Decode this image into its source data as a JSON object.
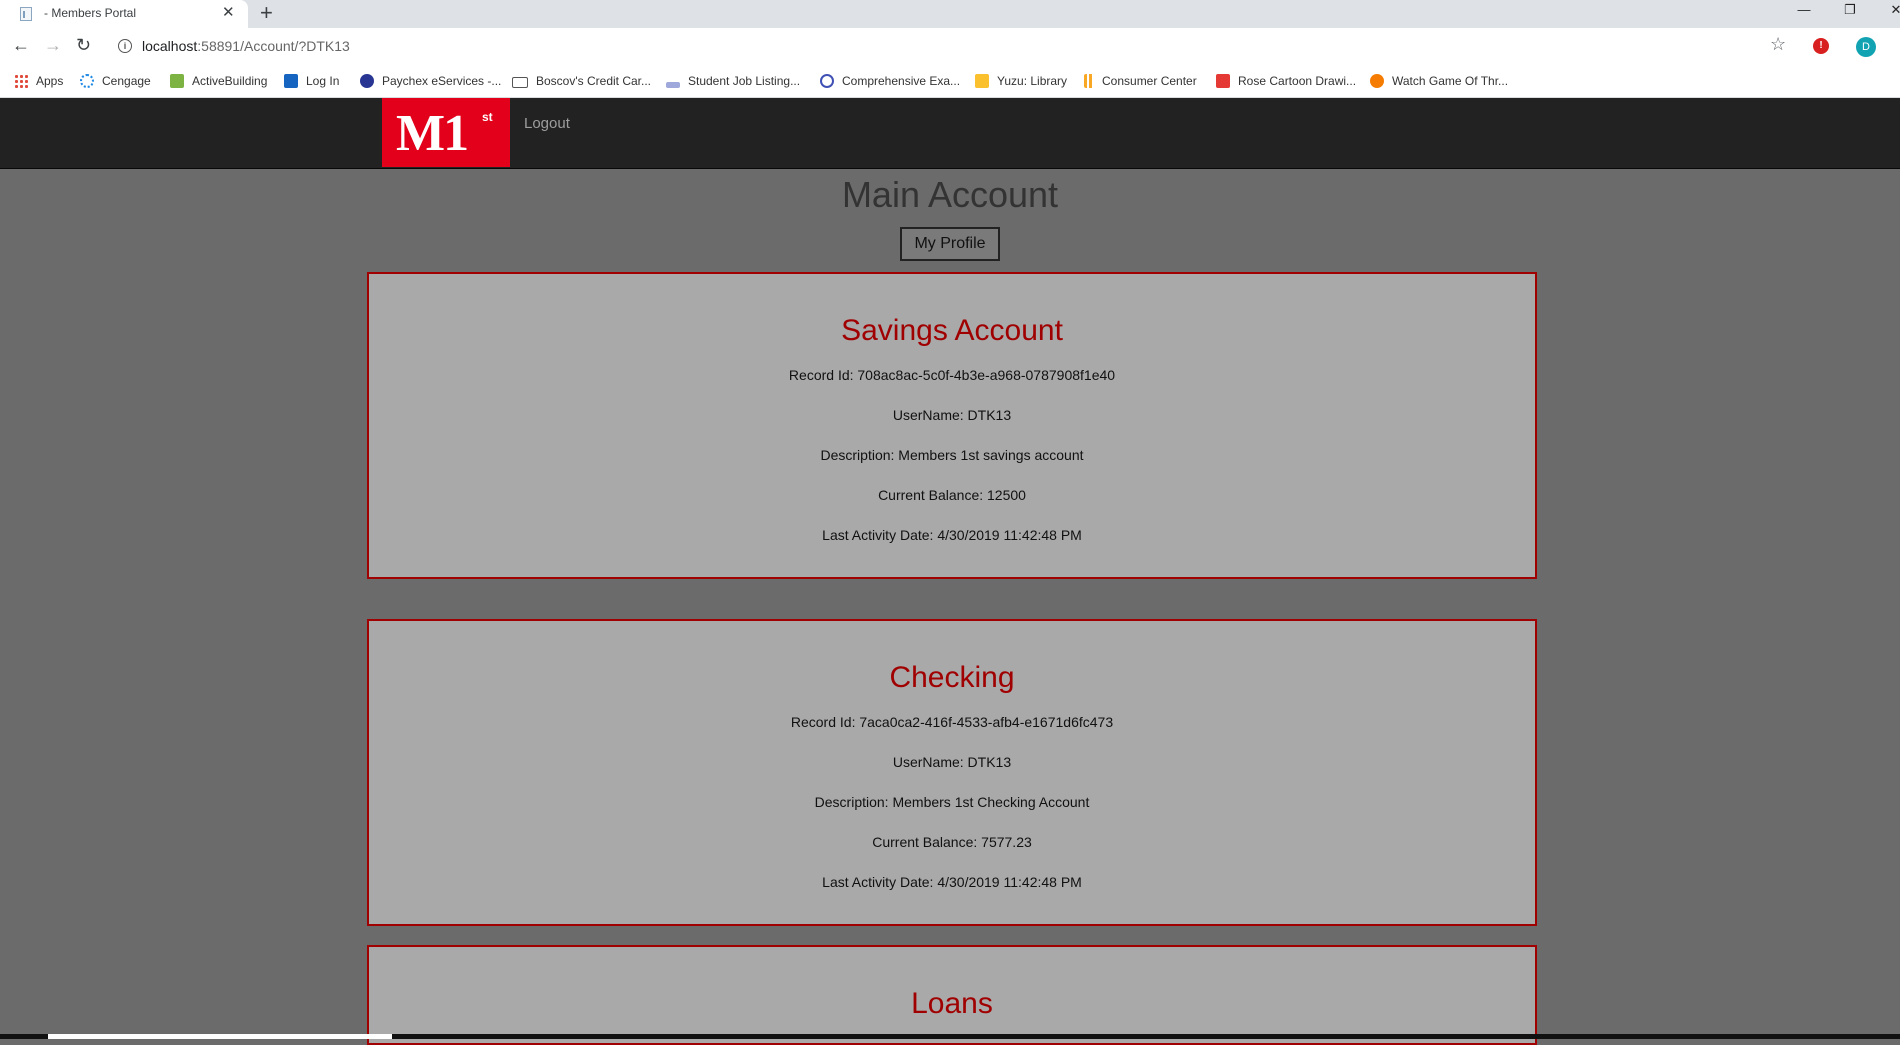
{
  "browser": {
    "tab_title": "- Members Portal",
    "new_tab": "+",
    "url_host": "localhost",
    "url_path": ":58891/Account/?DTK13",
    "avatar_letter": "D",
    "bookmarks": [
      {
        "label": "Apps",
        "icon": "apps-icon"
      },
      {
        "label": "Cengage",
        "icon": "cengage-icon",
        "color": "#1e88e5"
      },
      {
        "label": "ActiveBuilding",
        "icon": "building-icon",
        "color": "#7cb342"
      },
      {
        "label": "Log In",
        "icon": "login-icon",
        "color": "#1565c0"
      },
      {
        "label": "Paychex eServices -...",
        "icon": "paychex-icon",
        "color": "#283593"
      },
      {
        "label": "Boscov's Credit Car...",
        "icon": "card-icon",
        "color": "#555555"
      },
      {
        "label": "Student Job Listing...",
        "icon": "job-icon",
        "color": "#3949ab"
      },
      {
        "label": "Comprehensive Exa...",
        "icon": "q-icon",
        "color": "#3f51b5"
      },
      {
        "label": "Yuzu: Library",
        "icon": "yuzu-icon",
        "color": "#fbc02d"
      },
      {
        "label": "Consumer Center",
        "icon": "chart-icon",
        "color": "#f9a825"
      },
      {
        "label": "Rose Cartoon Drawi...",
        "icon": "c-icon",
        "color": "#e53935"
      },
      {
        "label": "Watch Game Of Thr...",
        "icon": "s-icon",
        "color": "#f57c00"
      }
    ]
  },
  "nav": {
    "logo_main": "M1",
    "logo_sup": "st",
    "logout_label": "Logout"
  },
  "page": {
    "title": "Main Account",
    "profile_button": "My Profile"
  },
  "accounts": [
    {
      "title": "Savings Account",
      "record": "Record Id: 708ac8ac-5c0f-4b3e-a968-0787908f1e40",
      "username": "UserName: DTK13",
      "description": "Description: Members 1st savings account",
      "balance": "Current Balance: 12500",
      "last_activity": "Last Activity Date: 4/30/2019 11:42:48 PM"
    },
    {
      "title": "Checking",
      "record": "Record Id: 7aca0ca2-416f-4533-afb4-e1671d6fc473",
      "username": "UserName: DTK13",
      "description": "Description: Members 1st Checking Account",
      "balance": "Current Balance: 7577.23",
      "last_activity": "Last Activity Date: 4/30/2019 11:42:48 PM"
    },
    {
      "title": "Loans"
    }
  ],
  "colors": {
    "brand_red": "#e2001a",
    "card_border": "#a00000",
    "page_bg": "#6b6b6b",
    "navbar_bg": "#222222"
  }
}
